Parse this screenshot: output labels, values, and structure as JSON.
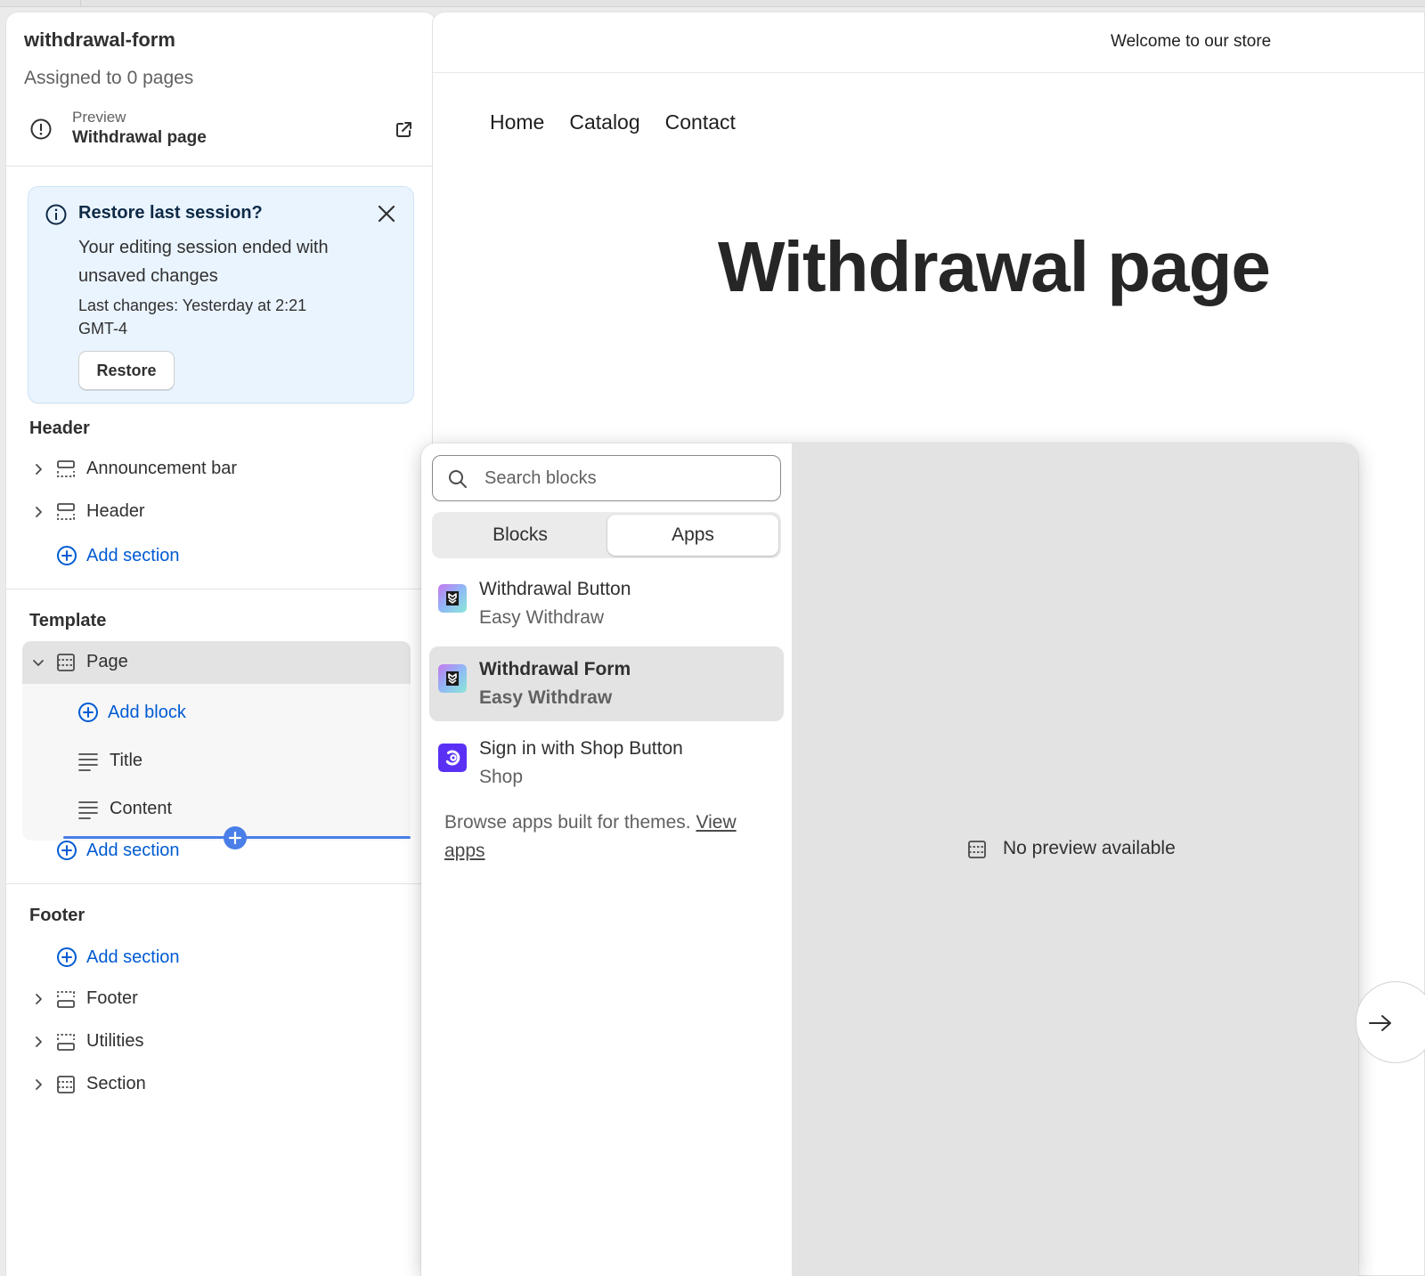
{
  "sidebar": {
    "title": "withdrawal-form",
    "subtitle": "Assigned to 0 pages",
    "preview": {
      "label": "Preview",
      "value": "Withdrawal page"
    },
    "banner": {
      "title": "Restore last session?",
      "body": "Your editing session ended with unsaved changes",
      "meta": "Last changes: Yesterday at 2:21 GMT-4",
      "button": "Restore"
    },
    "header_group": {
      "heading": "Header",
      "sections": [
        {
          "label": "Announcement bar"
        },
        {
          "label": "Header"
        }
      ],
      "add_label": "Add section"
    },
    "template_group": {
      "heading": "Template",
      "page_label": "Page",
      "add_block_label": "Add block",
      "blocks": [
        {
          "label": "Title"
        },
        {
          "label": "Content"
        }
      ],
      "add_label": "Add section"
    },
    "footer_group": {
      "heading": "Footer",
      "add_label": "Add section",
      "sections": [
        {
          "label": "Footer"
        },
        {
          "label": "Utilities"
        },
        {
          "label": "Section"
        }
      ]
    }
  },
  "storefront": {
    "announcement": "Welcome to our store",
    "nav": [
      "Home",
      "Catalog",
      "Contact"
    ],
    "title": "Withdrawal page"
  },
  "picker": {
    "search_placeholder": "Search blocks",
    "tabs": [
      {
        "label": "Blocks",
        "active": false
      },
      {
        "label": "Apps",
        "active": true
      }
    ],
    "apps": [
      {
        "name": "Withdrawal Button",
        "vendor": "Easy Withdraw",
        "icon": "easy-withdraw-app-icon",
        "selected": false
      },
      {
        "name": "Withdrawal Form",
        "vendor": "Easy Withdraw",
        "icon": "easy-withdraw-app-icon",
        "selected": true
      },
      {
        "name": "Sign in with Shop Button",
        "vendor": "Shop",
        "icon": "shop-app-icon",
        "selected": false
      }
    ],
    "browse_text": "Browse apps built for themes.",
    "browse_link": "View apps",
    "no_preview": "No preview available"
  },
  "colors": {
    "accent_blue": "#005bd3",
    "banner_bg": "#eaf4ff",
    "selected_bg": "#e3e3e3",
    "insert_line": "#4a7ee8",
    "shop_purple": "#5a31f4"
  }
}
